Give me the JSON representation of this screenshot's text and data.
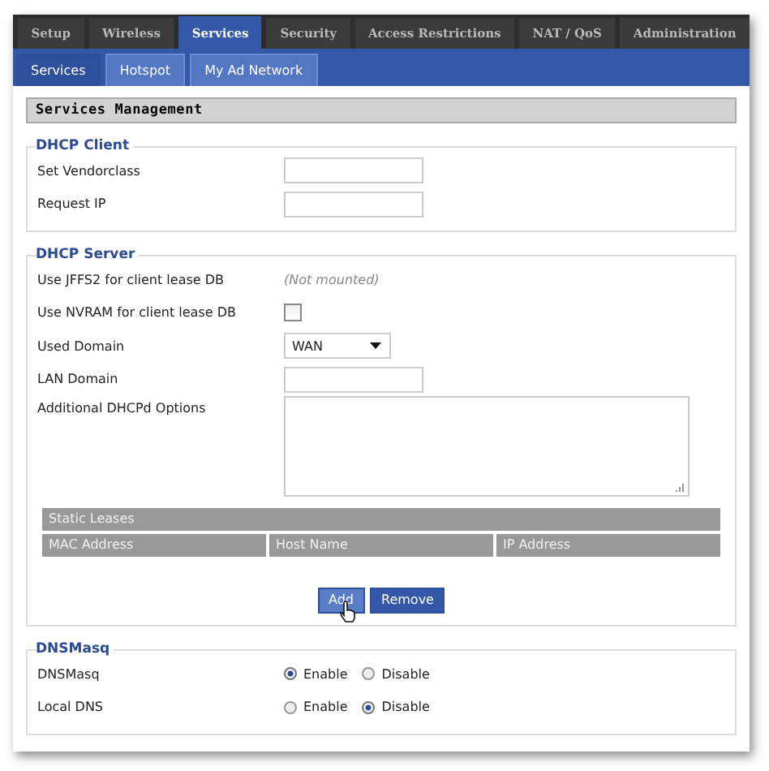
{
  "tabs": [
    {
      "label": "Setup",
      "selected": false
    },
    {
      "label": "Wireless",
      "selected": false
    },
    {
      "label": "Services",
      "selected": true
    },
    {
      "label": "Security",
      "selected": false
    },
    {
      "label": "Access Restrictions",
      "selected": false
    },
    {
      "label": "NAT / QoS",
      "selected": false
    },
    {
      "label": "Administration",
      "selected": false
    }
  ],
  "subtabs": [
    {
      "label": "Services",
      "selected": true
    },
    {
      "label": "Hotspot",
      "selected": false
    },
    {
      "label": "My Ad Network",
      "selected": false
    }
  ],
  "section_title": "Services Management",
  "fieldsets": [
    {
      "legend": "DHCP Client",
      "rows": [
        {
          "kind": "text",
          "label": "Set Vendorclass"
        },
        {
          "kind": "text",
          "label": "Request IP"
        }
      ]
    },
    {
      "legend": "DHCP Server",
      "rows": [
        {
          "kind": "note",
          "label": "Use JFFS2 for client lease DB",
          "note": "(Not mounted)"
        },
        {
          "kind": "checkbox",
          "label": "Use NVRAM for client lease DB",
          "checked": false
        },
        {
          "kind": "select",
          "label": "Used Domain",
          "value": "WAN"
        },
        {
          "kind": "text",
          "label": "LAN Domain"
        },
        {
          "kind": "textarea",
          "label": "Additional DHCPd Options"
        }
      ],
      "table": {
        "title": "Static Leases",
        "columns": [
          "MAC Address",
          "Host Name",
          "IP Address"
        ]
      },
      "buttons": [
        {
          "label": "Add",
          "hovered": true
        },
        {
          "label": "Remove",
          "hovered": false
        }
      ]
    },
    {
      "legend": "DNSMasq",
      "rows": [
        {
          "kind": "radio",
          "label": "DNSMasq",
          "options": [
            {
              "label": "Enable",
              "selected": true
            },
            {
              "label": "Disable",
              "selected": false
            }
          ]
        },
        {
          "kind": "radio",
          "label": "Local DNS",
          "options": [
            {
              "label": "Enable",
              "selected": false
            },
            {
              "label": "Disable",
              "selected": true
            }
          ]
        }
      ]
    }
  ]
}
